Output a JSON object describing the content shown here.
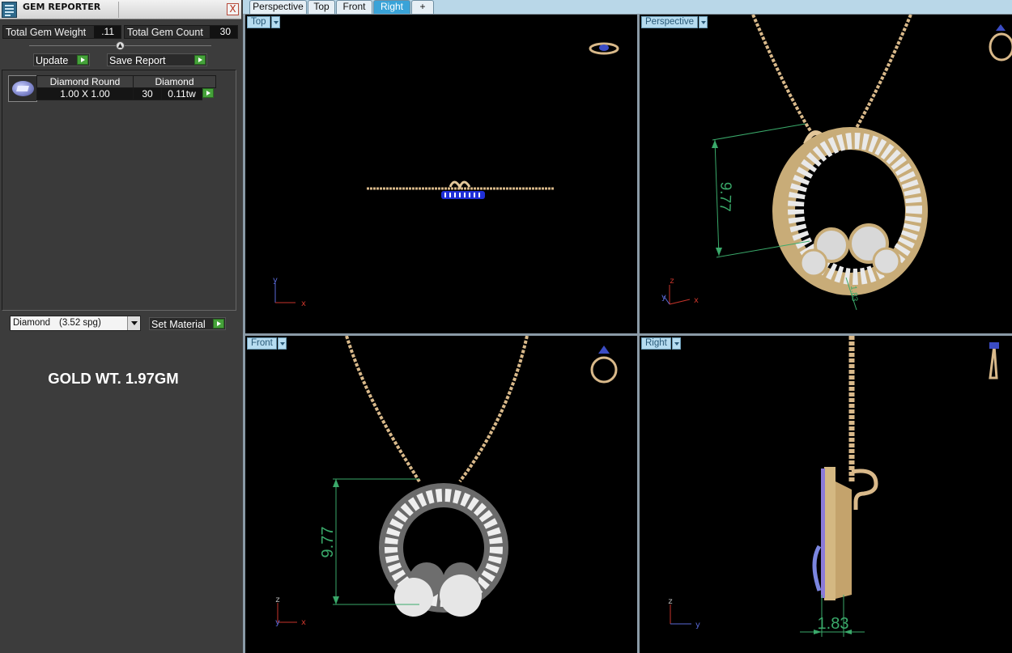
{
  "panel": {
    "title": "GEM REPORTER",
    "close_label": "X",
    "total_gem_weight_label": "Total Gem Weight",
    "total_gem_weight_value": ".11",
    "total_gem_count_label": "Total Gem Count",
    "total_gem_count_value": "30",
    "update_label": "Update",
    "save_report_label": "Save Report",
    "gem_row": {
      "shape": "Diamond Round",
      "material": "Diamond",
      "size": "1.00 X 1.00",
      "count": "30",
      "weight": "0.11tw"
    },
    "material_select": {
      "name": "Diamond",
      "sg": "(3.52 spg)"
    },
    "set_material_label": "Set Material",
    "note": "GOLD WT. 1.97GM"
  },
  "tabs": [
    {
      "label": "Perspective",
      "active": false
    },
    {
      "label": "Top",
      "active": false
    },
    {
      "label": "Front",
      "active": false
    },
    {
      "label": "Right",
      "active": true
    },
    {
      "label": "+",
      "active": false
    }
  ],
  "viewports": {
    "top": {
      "label": "Top",
      "axis_1": "y",
      "axis_2": "x"
    },
    "perspective": {
      "label": "Perspective",
      "axis_1": "z",
      "axis_2": "y",
      "axis_3": "x",
      "dimension": "9.77",
      "dimension_small": "1.83"
    },
    "front": {
      "label": "Front",
      "axis_1": "z",
      "axis_2": "y",
      "axis_3": "x",
      "dimension": "9.77"
    },
    "right": {
      "label": "Right",
      "axis_1": "z",
      "axis_2": "y",
      "dimension": "1.83"
    }
  },
  "colors": {
    "gold": "#d9b98a",
    "diamond": "#e6e6e6",
    "dimension_green": "#3aa96a",
    "axis_red": "#c8352b",
    "axis_blue": "#5a6ad8",
    "tab_active": "#39a3d8"
  }
}
